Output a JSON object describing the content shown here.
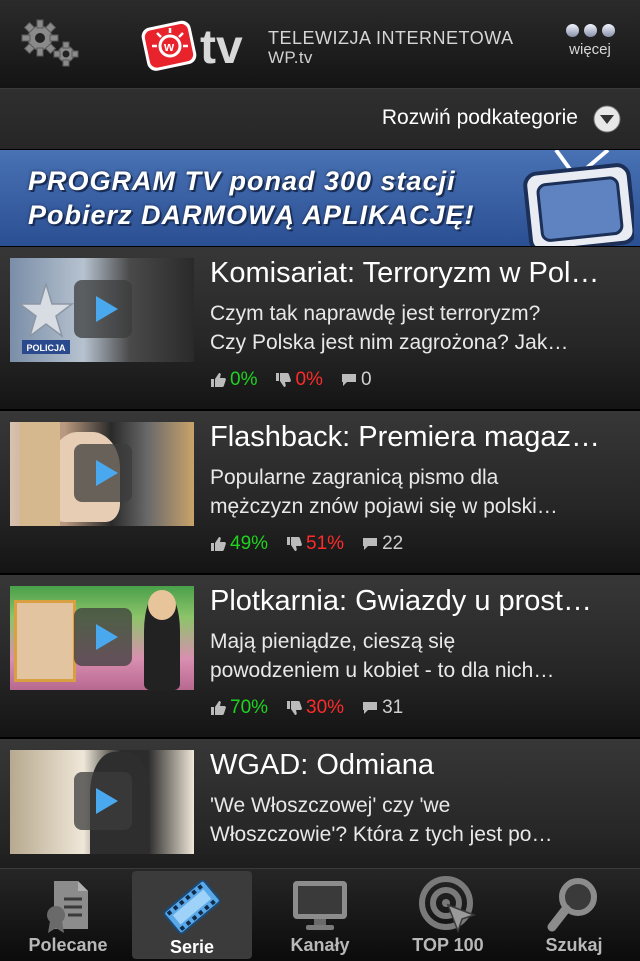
{
  "header": {
    "brand_line1": "TELEWIZJA INTERNETOWA",
    "brand_line2": "WP.tv",
    "logo_text": "tv",
    "more_label": "więcej",
    "icons": {
      "settings": "gear-icon",
      "more": "dots-icon"
    }
  },
  "subcategory": {
    "label": "Rozwiń podkategorie"
  },
  "banner": {
    "line1": "PROGRAM TV ponad 300 stacji",
    "line2": "Pobierz DARMOWĄ APLIKACJĘ!"
  },
  "items": [
    {
      "title": "Komisariat: Terroryzm w Pol…",
      "desc1": "Czym tak naprawdę jest terroryzm?",
      "desc2": "Czy Polska jest nim zagrożona? Jak…",
      "likes": "0%",
      "dislikes": "0%",
      "comments": "0",
      "badge": "POLICJA"
    },
    {
      "title": "Flashback: Premiera magaz…",
      "desc1": "Popularne zagranicą pismo dla",
      "desc2": "mężczyzn znów pojawi się w polski…",
      "likes": "49%",
      "dislikes": "51%",
      "comments": "22"
    },
    {
      "title": "Plotkarnia: Gwiazdy u prost…",
      "desc1": "Mają pieniądze, cieszą się",
      "desc2": "powodzeniem u kobiet - to dla nich…",
      "likes": "70%",
      "dislikes": "30%",
      "comments": "31"
    },
    {
      "title": "WGAD: Odmiana",
      "desc1": "'We Włoszczowej' czy 'we",
      "desc2": "Włoszczowie'? Która z tych jest po…",
      "likes": "",
      "dislikes": "",
      "comments": ""
    }
  ],
  "tabs": [
    {
      "label": "Polecane",
      "icon": "document-icon"
    },
    {
      "label": "Serie",
      "icon": "film-icon",
      "active": true
    },
    {
      "label": "Kanały",
      "icon": "monitor-icon"
    },
    {
      "label": "TOP 100",
      "icon": "target-icon"
    },
    {
      "label": "Szukaj",
      "icon": "magnifier-icon"
    }
  ],
  "colors": {
    "positive": "#1fd31f",
    "negative": "#ff2a2a",
    "banner": "#3a62a8",
    "play": "#4aa8ee",
    "logo_red": "#e8232b"
  }
}
